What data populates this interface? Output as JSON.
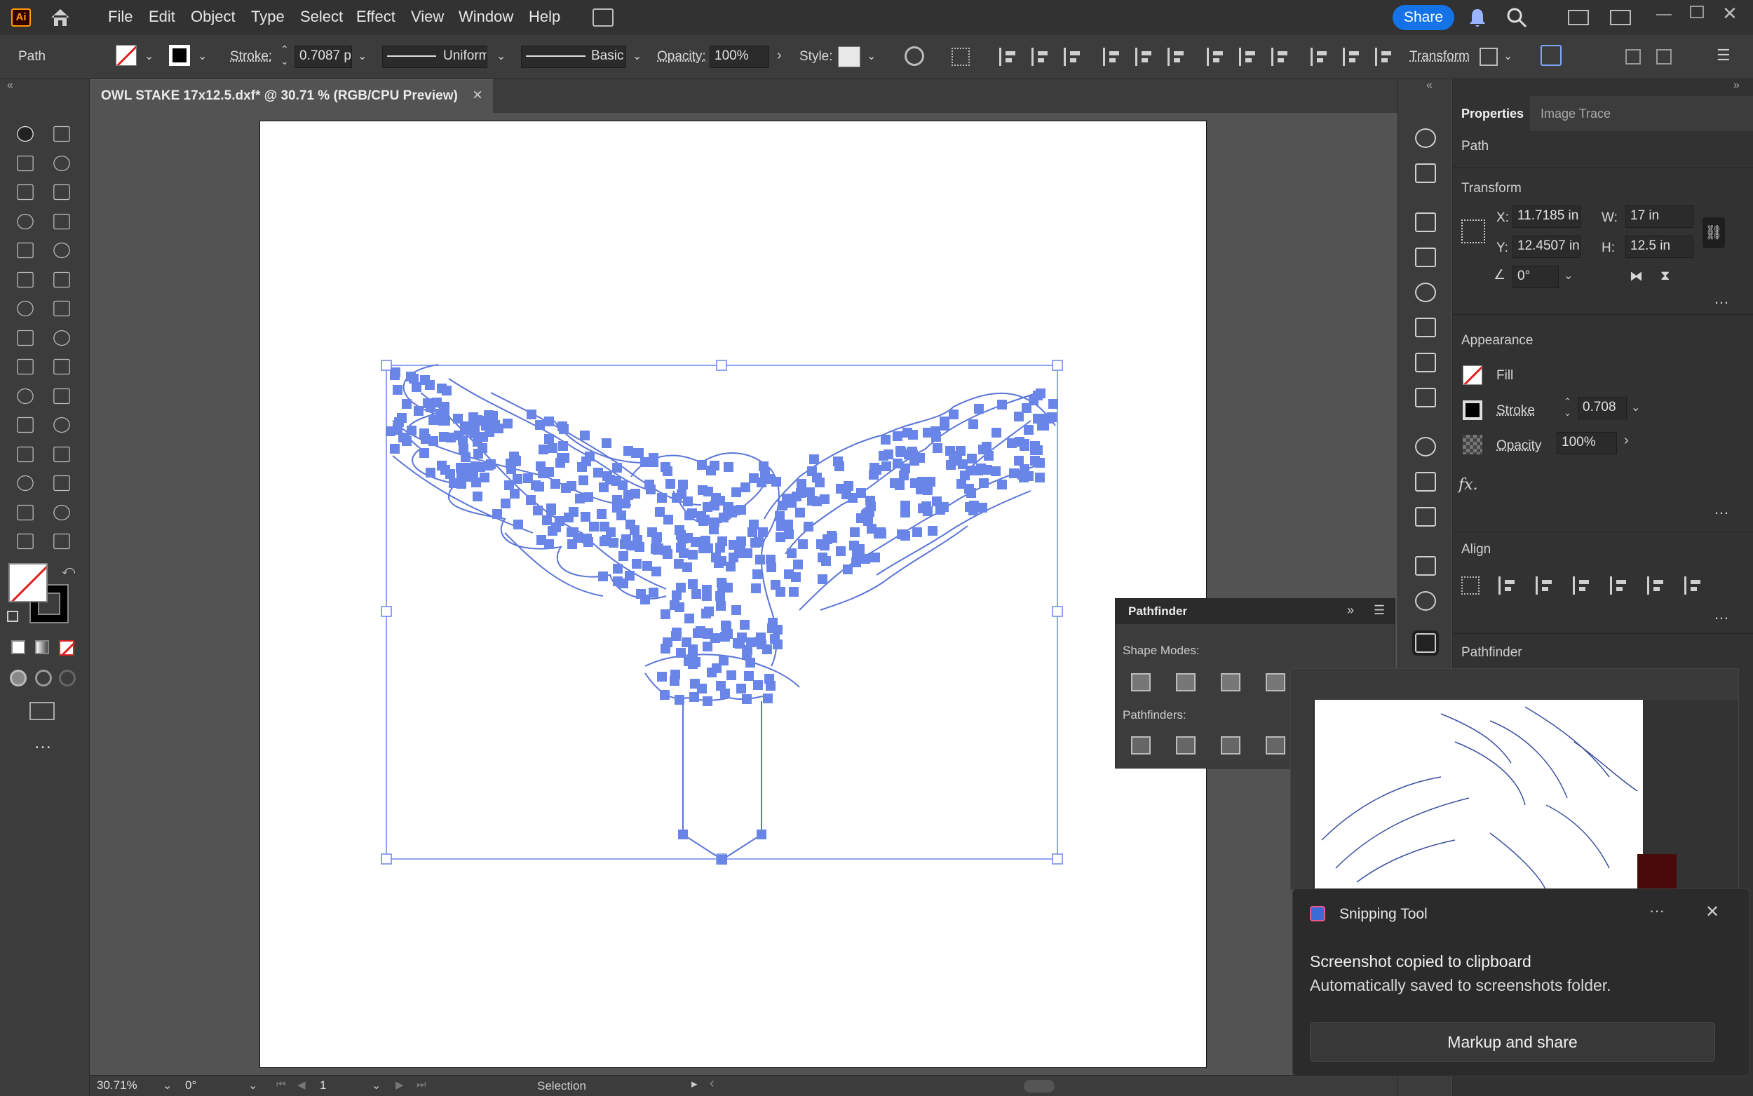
{
  "app": {
    "logo": "Ai",
    "accent": "#ff9a00",
    "share_label": "Share",
    "share_color": "#1473e6"
  },
  "menu": [
    "File",
    "Edit",
    "Object",
    "Type",
    "Select",
    "Effect",
    "View",
    "Window",
    "Help"
  ],
  "control_bar": {
    "selection_type": "Path",
    "stroke_label": "Stroke:",
    "stroke_value": "0.7087 p",
    "profile_uniform": "Uniform",
    "brush_basic": "Basic",
    "opacity_label": "Opacity:",
    "opacity_value": "100%",
    "style_label": "Style:",
    "transform_label": "Transform"
  },
  "document": {
    "tab_title": "OWL STAKE 17x12.5.dxf* @ 30.71 % (RGB/CPU Preview)"
  },
  "status_bar": {
    "zoom": "30.71%",
    "rotation": "0°",
    "artboard_number": "1",
    "tool_name": "Selection"
  },
  "properties": {
    "tab_active": "Properties",
    "tab_other": "Image Trace",
    "object_type": "Path",
    "transform": {
      "heading": "Transform",
      "x_label": "X:",
      "x": "11.7185 in",
      "y_label": "Y:",
      "y": "12.4507 in",
      "w_label": "W:",
      "w": "17 in",
      "h_label": "H:",
      "h": "12.5 in",
      "angle": "0°"
    },
    "appearance": {
      "heading": "Appearance",
      "fill_label": "Fill",
      "stroke_label": "Stroke",
      "stroke_value": "0.708",
      "opacity_label": "Opacity",
      "opacity_value": "100%",
      "fx": "fx."
    },
    "align_heading": "Align",
    "pathfinder_heading": "Pathfinder"
  },
  "pathfinder_panel": {
    "title": "Pathfinder",
    "shape_modes": "Shape Modes:",
    "pathfinders": "Pathfinders:"
  },
  "toast": {
    "app_name": "Snipping Tool",
    "title": "Screenshot copied to clipboard",
    "body": "Automatically saved to screenshots folder.",
    "action": "Markup and share"
  },
  "colors": {
    "selection": "#6a85e8",
    "panel_dark": "#323232",
    "panel": "#3c3c3c",
    "canvas_bg": "#535353"
  }
}
